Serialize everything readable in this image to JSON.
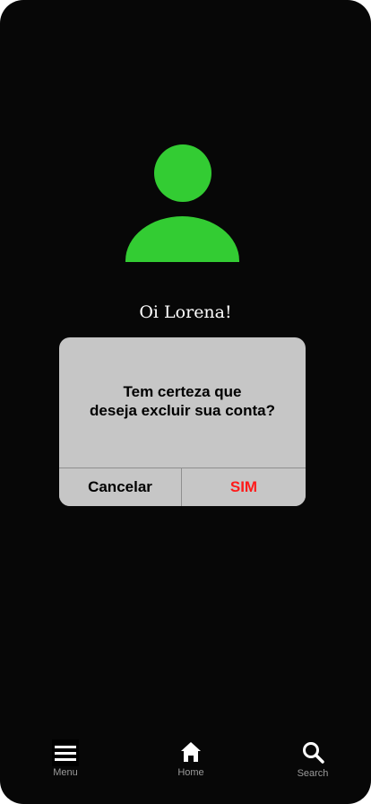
{
  "profile": {
    "avatar_icon": "user-avatar-icon",
    "avatar_color": "#33cc33",
    "greeting": "Oi Lorena!"
  },
  "dialog": {
    "message_line1": "Tem certeza que",
    "message_line2": "deseja excluir sua conta?",
    "cancel_label": "Cancelar",
    "confirm_label": "SIM",
    "confirm_color": "#ff1a1a"
  },
  "bottom_nav": {
    "items": [
      {
        "label": "Menu",
        "icon": "hamburger-menu-icon"
      },
      {
        "label": "Home",
        "icon": "home-icon"
      },
      {
        "label": "Search",
        "icon": "search-icon"
      }
    ]
  }
}
